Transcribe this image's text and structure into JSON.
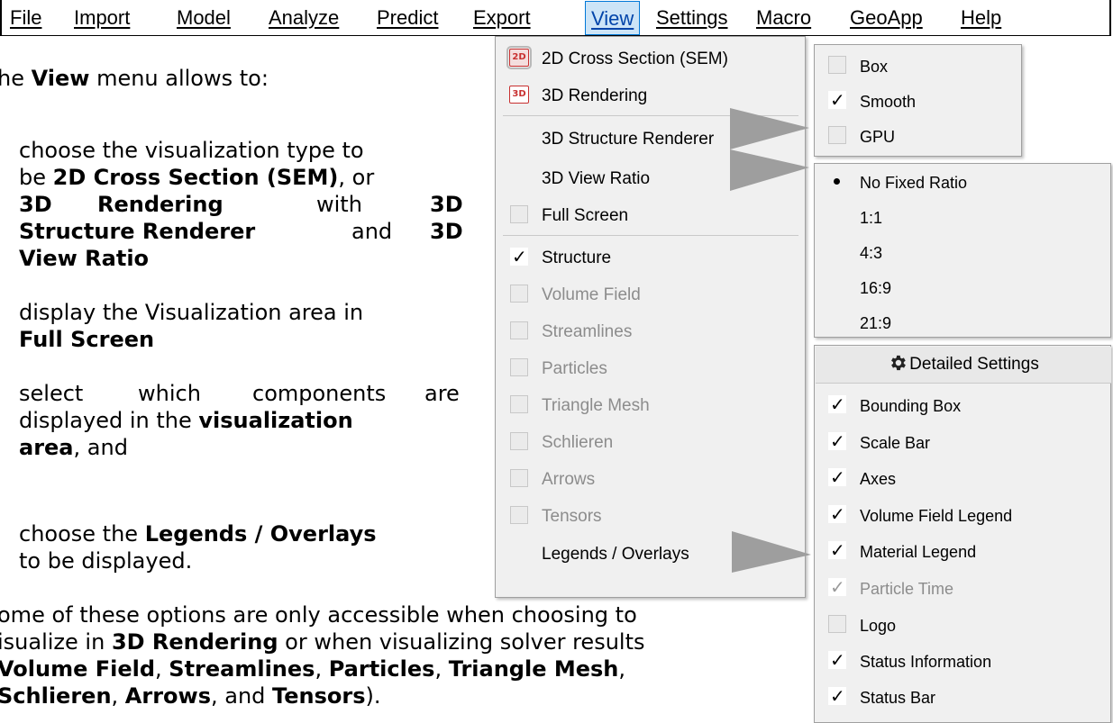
{
  "menubar": {
    "items": [
      {
        "label": "File",
        "active": false
      },
      {
        "label": "Import",
        "active": false
      },
      {
        "label": "Model",
        "active": false
      },
      {
        "label": "Analyze",
        "active": false
      },
      {
        "label": "Predict",
        "active": false
      },
      {
        "label": "Export",
        "active": false
      },
      {
        "label": "View",
        "active": true
      },
      {
        "label": "Settings",
        "active": false
      },
      {
        "label": "Macro",
        "active": false
      },
      {
        "label": "GeoApp",
        "active": false
      },
      {
        "label": "Help",
        "active": false
      }
    ]
  },
  "doc": {
    "intro_prefix": "he ",
    "intro_bold": "View",
    "intro_suffix": " menu allows to:",
    "bullet1": {
      "line1": "choose the visualization type to",
      "line2_prefix": "be ",
      "line2_bold": "2D Cross Section (SEM)",
      "line2_suffix": ", or",
      "line3_a": "3D",
      "line3_b": "Rendering",
      "line3_c": "with",
      "line3_d": "3D",
      "line4_a": "Structure Renderer",
      "line4_b": "and",
      "line4_c": "3D",
      "line5": "View Ratio"
    },
    "bullet2": {
      "line1": "display the Visualization area in",
      "line2": "Full Screen"
    },
    "bullet3": {
      "line1_a": "select",
      "line1_b": "which",
      "line1_c": "components",
      "line1_d": "are",
      "line2_prefix": "displayed in the ",
      "line2_bold": "visualization",
      "line3_bold": "area",
      "line3_suffix": ", and"
    },
    "bullet4": {
      "line1_prefix": "choose the ",
      "line1_bold": "Legends / Overlays",
      "line2": "to be displayed."
    },
    "note": {
      "line1": "ome of these options are only accessible when choosing to",
      "line2_prefix": "isualize in ",
      "line2_bold": "3D Rendering",
      "line2_suffix": " or when visualizing solver results",
      "line3_b1": "Volume Field",
      "line3_s1": ", ",
      "line3_b2": "Streamlines",
      "line3_s2": ", ",
      "line3_b3": "Particles",
      "line3_s3": ", ",
      "line3_b4": "Triangle Mesh",
      "line3_s4": ",",
      "line4_b1": "Schlieren",
      "line4_s1": ", ",
      "line4_b2": "Arrows",
      "line4_s2": ", and ",
      "line4_b3": "Tensors",
      "line4_s3": ")."
    }
  },
  "view_menu": {
    "cross_section": "2D Cross Section (SEM)",
    "cross_section_icon": "2D",
    "rendering": "3D Rendering",
    "rendering_icon": "3D",
    "structure_renderer": "3D Structure Renderer",
    "view_ratio": "3D View Ratio",
    "full_screen": "Full Screen",
    "structure": "Structure",
    "volume_field": "Volume Field",
    "streamlines": "Streamlines",
    "particles": "Particles",
    "triangle_mesh": "Triangle Mesh",
    "schlieren": "Schlieren",
    "arrows": "Arrows",
    "tensors": "Tensors",
    "legends": "Legends / Overlays"
  },
  "renderer_menu": {
    "box": "Box",
    "smooth": "Smooth",
    "gpu": "GPU"
  },
  "ratio_menu": {
    "no_fixed": "No Fixed Ratio",
    "r1": "1:1",
    "r2": "4:3",
    "r3": "16:9",
    "r4": "21:9"
  },
  "overlays_menu": {
    "header": "Detailed Settings",
    "bounding_box": "Bounding Box",
    "scale_bar": "Scale Bar",
    "axes": "Axes",
    "volume_legend": "Volume Field Legend",
    "material_legend": "Material Legend",
    "particle_time": "Particle Time",
    "logo": "Logo",
    "status_info": "Status Information",
    "status_bar": "Status Bar"
  },
  "check_glyph": "✓",
  "colors": {
    "menu_bg": "#f0f0f0",
    "highlight": "#cce4f7",
    "disabled": "#8c8c8c",
    "icon_red": "#c83030",
    "arrow": "#9e9e9e"
  }
}
